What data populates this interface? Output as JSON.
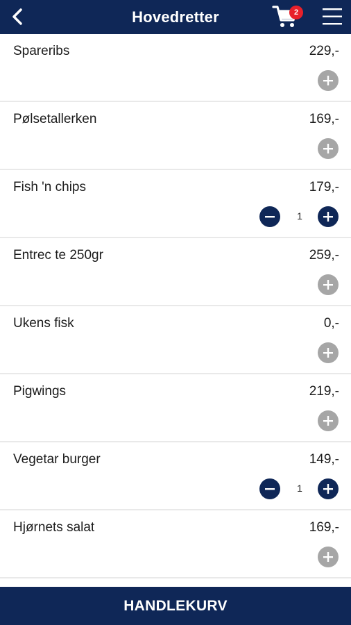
{
  "header": {
    "title": "Hovedretter",
    "cart_count": "2",
    "back_icon": "chevron-left-icon",
    "cart_icon": "shopping-cart-icon",
    "menu_icon": "hamburger-menu-icon"
  },
  "colors": {
    "brand": "#0f2757",
    "badge": "#e8202a",
    "inactive_control": "#a6a6a6"
  },
  "items": [
    {
      "name": "Spareribs",
      "price": "229,-",
      "qty": null
    },
    {
      "name": "Pølsetallerken",
      "price": "169,-",
      "qty": null
    },
    {
      "name": "Fish 'n chips",
      "price": "179,-",
      "qty": "1"
    },
    {
      "name": "Entrec te 250gr",
      "price": "259,-",
      "qty": null
    },
    {
      "name": "Ukens fisk",
      "price": "0,-",
      "qty": null
    },
    {
      "name": "Pigwings",
      "price": "219,-",
      "qty": null
    },
    {
      "name": "Vegetar burger",
      "price": "149,-",
      "qty": "1"
    },
    {
      "name": "Hjørnets salat",
      "price": "169,-",
      "qty": null
    }
  ],
  "footer": {
    "checkout_label": "HANDLEKURV"
  }
}
